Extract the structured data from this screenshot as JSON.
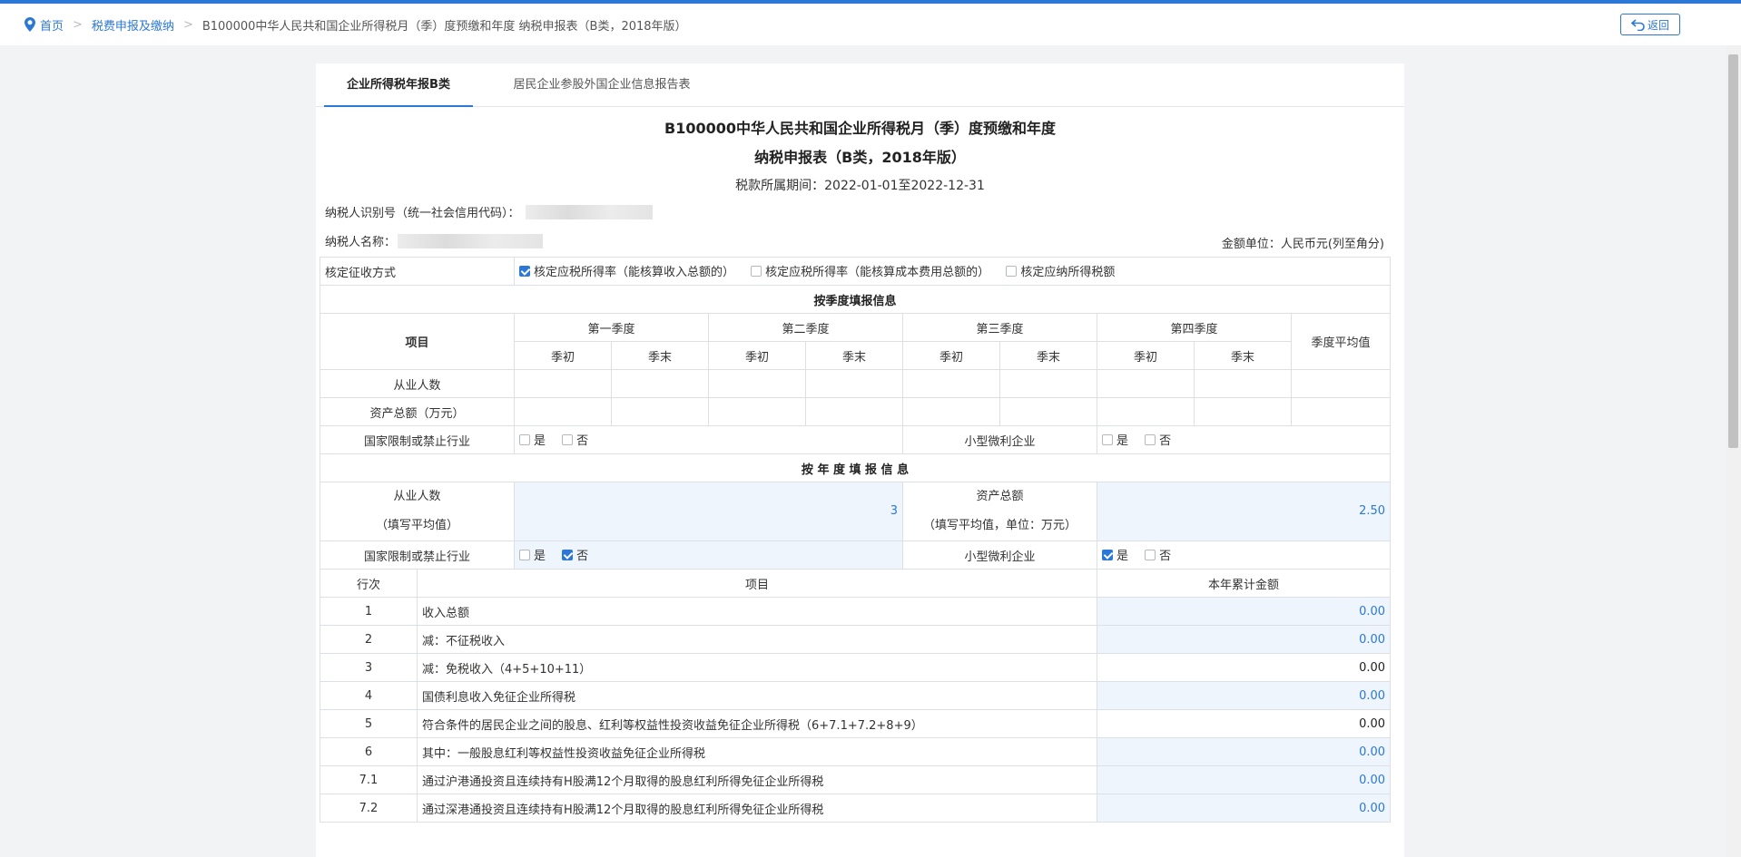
{
  "breadcrumb": {
    "home": "首页",
    "section": "税费申报及缴纳",
    "current": "B100000中华人民共和国企业所得税月（季）度预缴和年度 纳税申报表（B类，2018年版）"
  },
  "back_label": "返回",
  "tabs": [
    "企业所得税年报B类",
    "居民企业参股外国企业信息报告表"
  ],
  "form": {
    "title_line1": "B100000中华人民共和国企业所得税月（季）度预缴和年度",
    "title_line2": "纳税申报表（B类，2018年版）",
    "period_label": "税款所属期间：",
    "period_value": "2022-01-01至2022-12-31",
    "taxpayer_id_label": "纳税人识别号（统一社会信用代码）：",
    "taxpayer_name_label": "纳税人名称：",
    "unit": "金额单位：人民币元(列至角分)"
  },
  "levy": {
    "label": "核定征收方式",
    "options": [
      {
        "label": "核定应税所得率（能核算收入总额的）",
        "checked": true
      },
      {
        "label": "核定应税所得率（能核算成本费用总额的）",
        "checked": false
      },
      {
        "label": "核定应纳所得税额",
        "checked": false
      }
    ]
  },
  "quarterly": {
    "section_title": "按季度填报信息",
    "item_header": "项目",
    "quarters": [
      "第一季度",
      "第二季度",
      "第三季度",
      "第四季度"
    ],
    "start": "季初",
    "end": "季末",
    "avg": "季度平均值",
    "rows": [
      "从业人数",
      "资产总额（万元）"
    ],
    "restricted_label": "国家限制或禁止行业",
    "small_label": "小型微利企业",
    "yes": "是",
    "no": "否"
  },
  "annual": {
    "section_title": "按 年 度 填 报 信 息",
    "emp_label": "从业人数",
    "emp_sub": "（填写平均值）",
    "emp_value": "3",
    "asset_label": "资产总额",
    "asset_sub": "（填写平均值，单位：万元）",
    "asset_value": "2.50",
    "restricted_label": "国家限制或禁止行业",
    "restricted_yes": false,
    "restricted_no": true,
    "small_label": "小型微利企业",
    "small_yes": true,
    "small_no": false
  },
  "lines": {
    "h_row": "行次",
    "h_item": "项目",
    "h_amount": "本年累计金额",
    "rows": [
      {
        "no": "1",
        "item": "收入总额",
        "amount": "0.00",
        "editable": true
      },
      {
        "no": "2",
        "item": "减：不征税收入",
        "amount": "0.00",
        "editable": true
      },
      {
        "no": "3",
        "item": "减：免税收入（4+5+10+11）",
        "amount": "0.00",
        "editable": false
      },
      {
        "no": "4",
        "item": "国债利息收入免征企业所得税",
        "amount": "0.00",
        "editable": true
      },
      {
        "no": "5",
        "item": "符合条件的居民企业之间的股息、红利等权益性投资收益免征企业所得税（6+7.1+7.2+8+9）",
        "amount": "0.00",
        "editable": false
      },
      {
        "no": "6",
        "item": "其中：一般股息红利等权益性投资收益免征企业所得税",
        "amount": "0.00",
        "editable": true
      },
      {
        "no": "7.1",
        "item": "通过沪港通投资且连续持有H股满12个月取得的股息红利所得免征企业所得税",
        "amount": "0.00",
        "editable": true
      },
      {
        "no": "7.2",
        "item": "通过深港通投资且连续持有H股满12个月取得的股息红利所得免征企业所得税",
        "amount": "0.00",
        "editable": true
      }
    ]
  },
  "colors": {
    "accent": "#2b78d6",
    "editable_bg": "#eef5fd"
  }
}
